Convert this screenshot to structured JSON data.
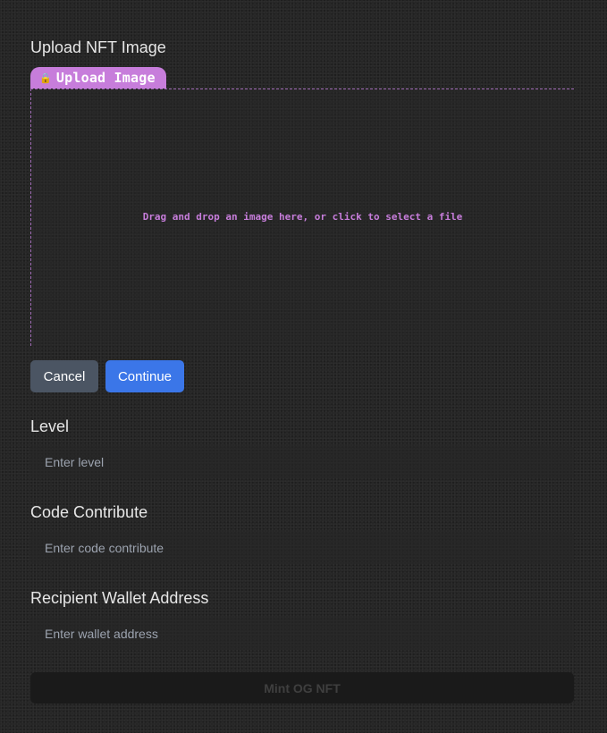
{
  "upload": {
    "heading": "Upload NFT Image",
    "tab_icon": "lock-icon",
    "tab_label": "Upload Image",
    "dropzone_text": "Drag and drop an image here, or click to select a file"
  },
  "actions": {
    "cancel_label": "Cancel",
    "continue_label": "Continue"
  },
  "fields": {
    "level": {
      "label": "Level",
      "placeholder": "Enter level",
      "value": ""
    },
    "code_contribute": {
      "label": "Code Contribute",
      "placeholder": "Enter code contribute",
      "value": ""
    },
    "wallet": {
      "label": "Recipient Wallet Address",
      "placeholder": "Enter wallet address",
      "value": ""
    }
  },
  "submit": {
    "label": "Mint OG NFT"
  },
  "colors": {
    "accent_purple": "#c77ddb",
    "continue_blue": "#3b76e8",
    "cancel_gray": "#4b5563",
    "background": "#262626"
  }
}
